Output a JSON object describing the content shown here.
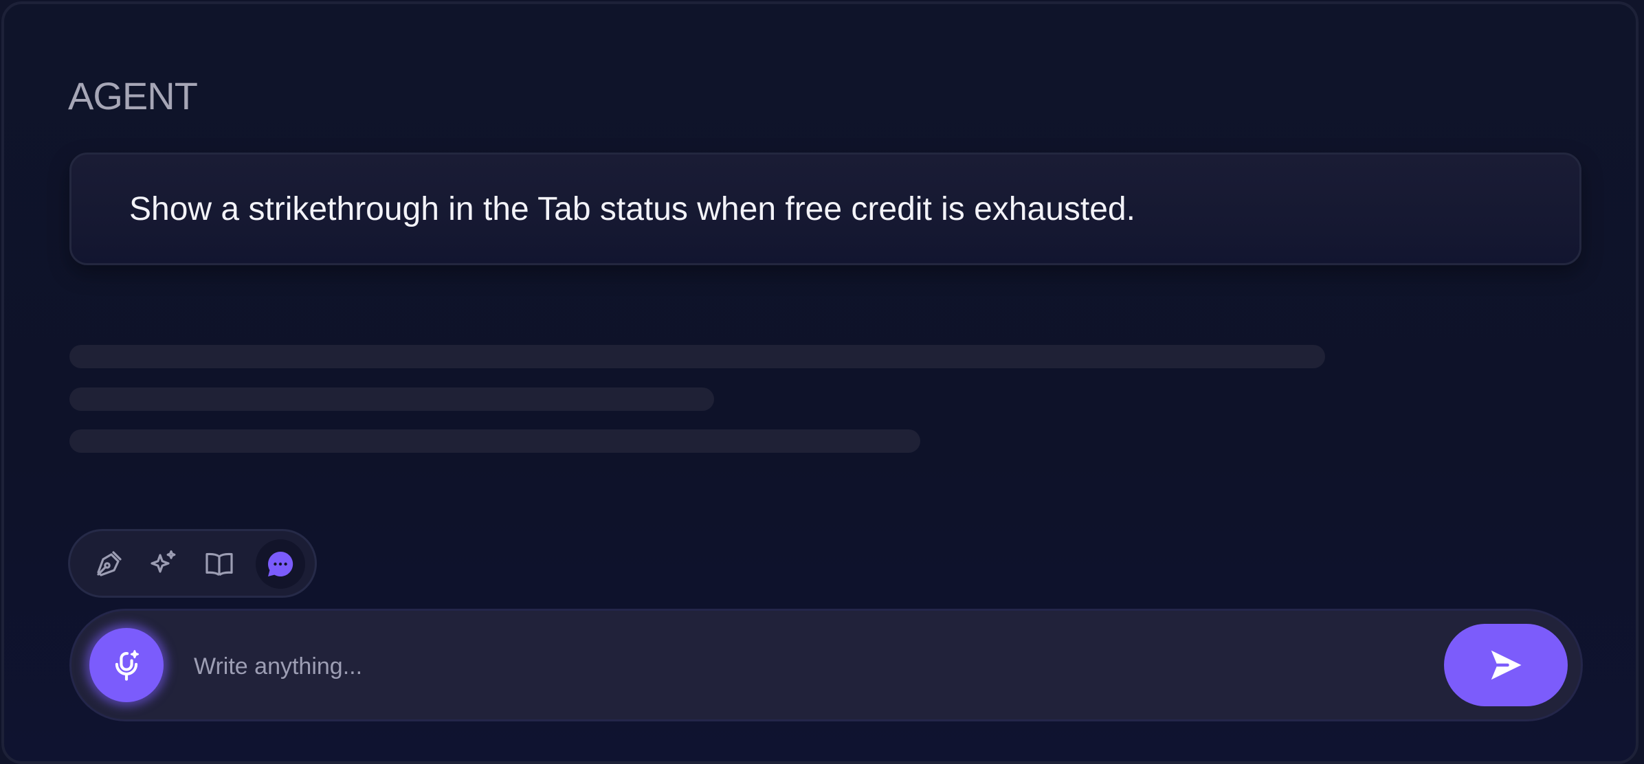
{
  "header": {
    "title": "AGENT"
  },
  "prompt": {
    "text": "Show a strikethrough in the Tab status when free credit is exhausted."
  },
  "response": {
    "state": "loading",
    "skeleton_lines": 3
  },
  "modes": [
    {
      "name": "pen-tool-icon",
      "active": false
    },
    {
      "name": "sparkles-icon",
      "active": false
    },
    {
      "name": "book-open-icon",
      "active": false
    },
    {
      "name": "chat-bubble-icon",
      "active": true
    }
  ],
  "composer": {
    "placeholder": "Write anything...",
    "value": "",
    "mic_icon": "mic-sparkle-icon",
    "send_icon": "send-icon"
  },
  "colors": {
    "accent": "#7b5cfc",
    "background": "#10142a",
    "card": "#1a1c35",
    "skeleton": "#1f2136",
    "icon_muted": "#9c9db3"
  }
}
